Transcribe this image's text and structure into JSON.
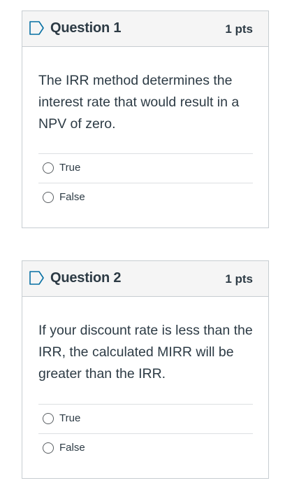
{
  "questions": [
    {
      "title": "Question 1",
      "points": "1 pts",
      "text": "The IRR method determines the interest rate that would result in a NPV of zero.",
      "icon": "flag-icon",
      "answers": [
        {
          "label": "True"
        },
        {
          "label": "False"
        }
      ]
    },
    {
      "title": "Question 2",
      "points": "1 pts",
      "text": "If your discount rate is less than the IRR, the calculated MIRR will be greater than the IRR.",
      "icon": "flag-icon",
      "answers": [
        {
          "label": "True"
        },
        {
          "label": "False"
        }
      ]
    }
  ],
  "colors": {
    "text": "#2d3b45",
    "border": "#c7cdd1",
    "header_bg": "#f5f5f5",
    "flag": "#0770a3"
  }
}
